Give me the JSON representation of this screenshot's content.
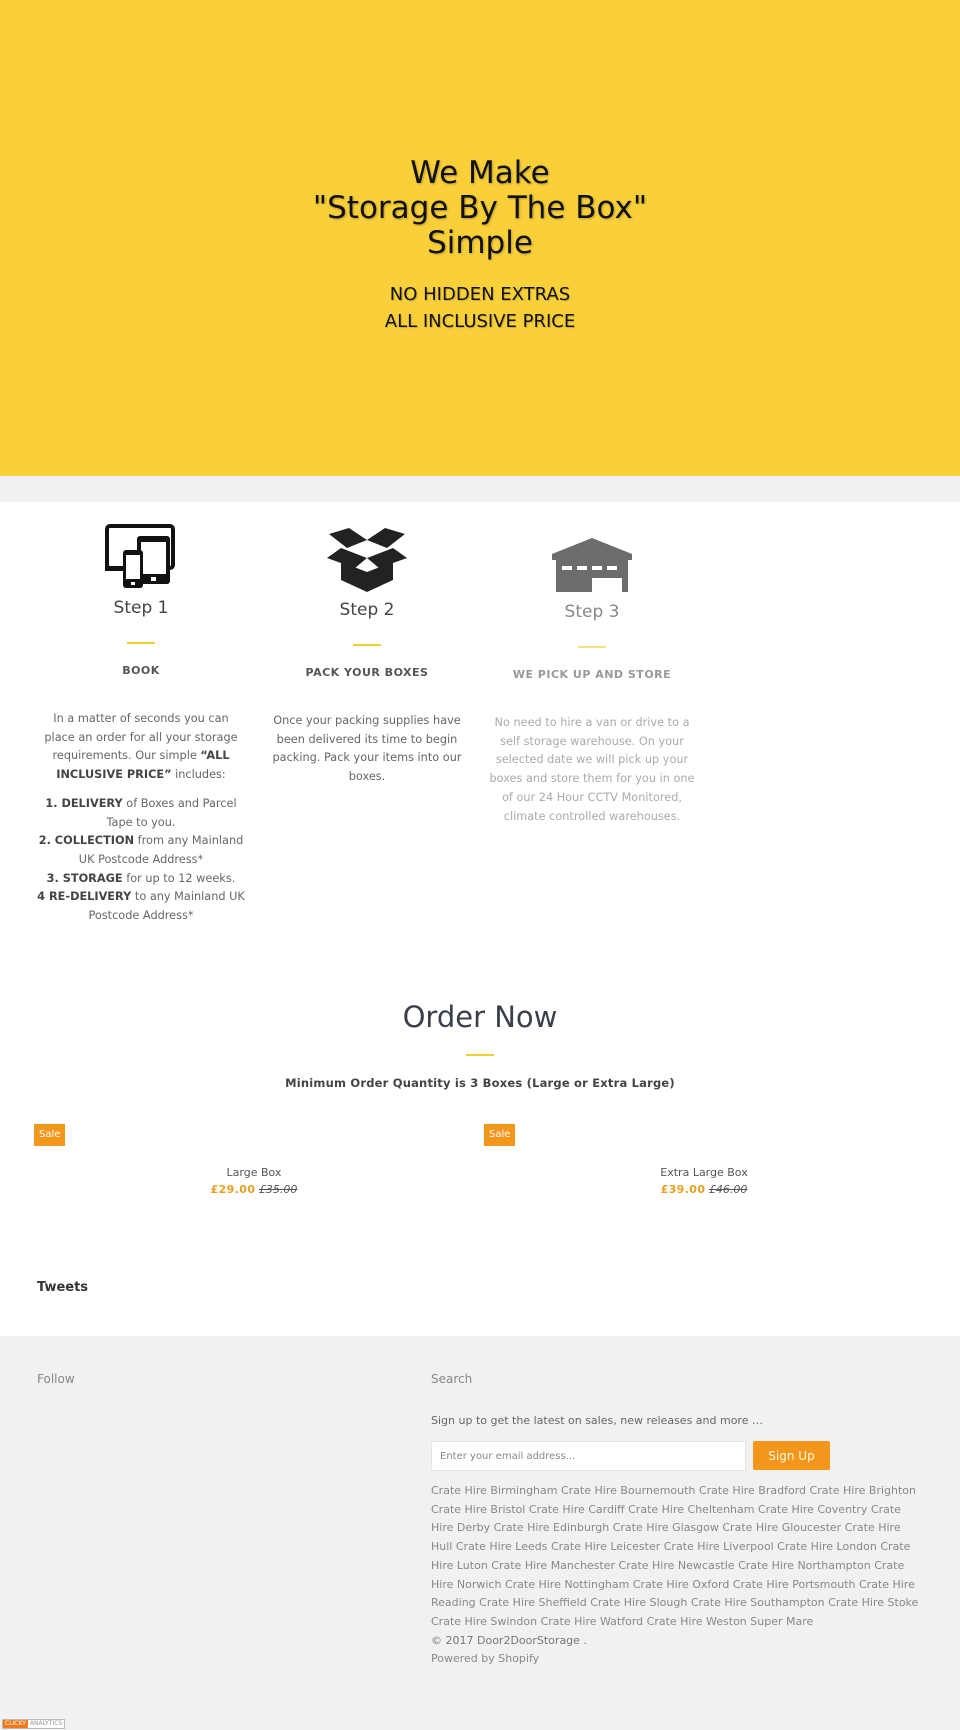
{
  "hero": {
    "title_lines": [
      "We Make",
      "\"Storage By The Box\"",
      "Simple"
    ],
    "subtitle_lines": [
      "NO HIDDEN EXTRAS",
      "ALL INCLUSIVE PRICE"
    ],
    "background_color": "#fad03a"
  },
  "steps": [
    {
      "icon": "devices-icon",
      "title": "Step 1",
      "subtitle": "BOOK",
      "intro": {
        "before": "In a matter of seconds you can place an order for all your storage requirements. Our simple ",
        "bold": "“ALL INCLUSIVE PRICE”",
        "after": " includes:"
      },
      "list": [
        {
          "bold": "1. DELIVERY",
          "text": " of Boxes and Parcel Tape to you."
        },
        {
          "bold": "2. COLLECTION",
          "text": " from any Mainland UK Postcode Address*"
        },
        {
          "bold": "3. STORAGE",
          "text": " for up to 12 weeks."
        },
        {
          "bold": "4 RE-DELIVERY",
          "text": " to any Mainland UK Postcode Address*"
        }
      ]
    },
    {
      "icon": "open-box-icon",
      "title": "Step 2",
      "subtitle": "PACK YOUR BOXES",
      "body": "Once your packing supplies have been delivered its time to begin packing. Pack your items into our boxes."
    },
    {
      "icon": "warehouse-icon",
      "title": "Step 3",
      "subtitle": "WE PICK UP AND STORE",
      "body": "No need to hire a van or drive to a self storage warehouse. On your selected date we will pick up your boxes and store them for you in one of our 24 Hour CCTV Monitored, climate controlled warehouses."
    }
  ],
  "order": {
    "title": "Order Now",
    "note": "Minimum Order Quantity is 3 Boxes (Large or Extra Large)",
    "products": [
      {
        "badge": "Sale",
        "name": "Large Box",
        "price": "£29.00",
        "compare_price": "£35.00"
      },
      {
        "badge": "Sale",
        "name": "Extra Large Box",
        "price": "£39.00",
        "compare_price": "£46.00"
      }
    ]
  },
  "tweets": {
    "heading": "Tweets"
  },
  "footer": {
    "follow_heading": "Follow",
    "search_heading": "Search",
    "signup_text": "Sign up to get the latest on sales, new releases and more …",
    "email_placeholder": "Enter your email address...",
    "signup_button": "Sign Up",
    "crate_links": [
      "Crate Hire Birmingham",
      "Crate Hire Bournemouth",
      "Crate Hire Bradford",
      "Crate Hire Brighton",
      "Crate Hire Bristol",
      "Crate Hire Cardiff",
      "Crate Hire Cheltenham",
      "Crate Hire Coventry",
      "Crate Hire Derby",
      "Crate Hire Edinburgh",
      "Crate Hire Glasgow",
      "Crate Hire Gloucester",
      "Crate Hire Hull",
      "Crate Hire Leeds",
      "Crate Hire Leicester",
      "Crate Hire Liverpool",
      "Crate Hire London",
      "Crate Hire Luton",
      "Crate Hire Manchester",
      "Crate Hire Newcastle",
      "Crate Hire Northampton",
      "Crate Hire Norwich",
      "Crate Hire Nottingham",
      "Crate Hire Oxford",
      "Crate Hire Portsmouth",
      "Crate Hire Reading",
      "Crate Hire Sheffield",
      "Crate Hire Slough",
      "Crate Hire Southampton",
      "Crate Hire Stoke",
      "Crate Hire Swindon",
      "Crate Hire Watford",
      "Crate Hire Weston Super Mare"
    ],
    "copyright": "© 2017 Door2DoorStorage .",
    "powered_by": "Powered by Shopify"
  },
  "badge": {
    "part1": "CLICKY",
    "part2": "ANALYTICS"
  },
  "colors": {
    "accent_yellow": "#f5cd2e",
    "sale_orange": "#f3961c",
    "price_gold": "#e8a020"
  }
}
